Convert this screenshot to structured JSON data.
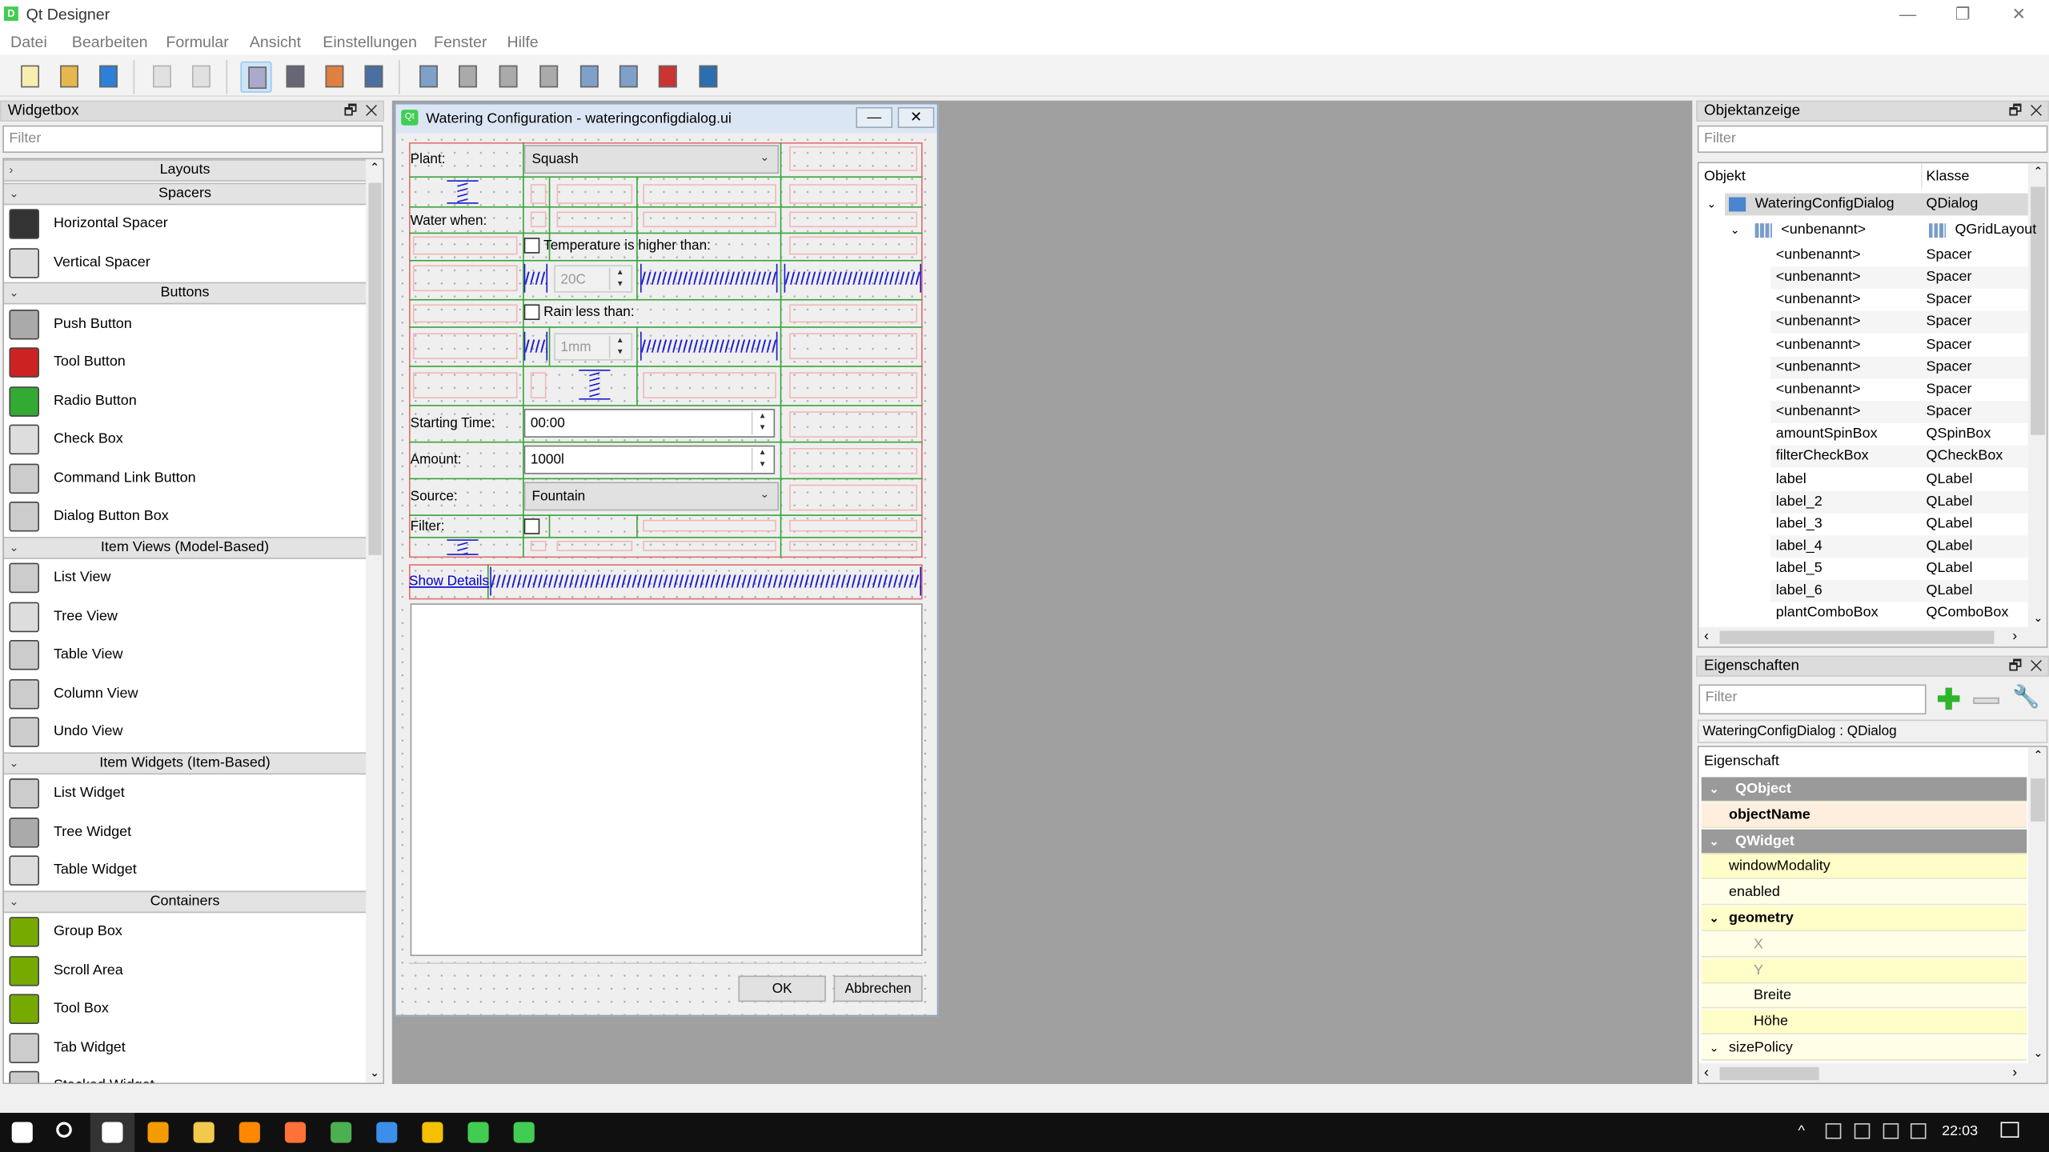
{
  "app": {
    "title": "Qt Designer",
    "icon": "qt-designer-icon"
  },
  "window_controls": {
    "minimize": "—",
    "maximize": "❐",
    "close": "✕"
  },
  "menu": [
    "Datei",
    "Bearbeiten",
    "Formular",
    "Ansicht",
    "Einstellungen",
    "Fenster",
    "Hilfe"
  ],
  "toolbar": [
    {
      "icon": "new-file-icon",
      "enabled": true
    },
    {
      "icon": "open-folder-icon",
      "enabled": true
    },
    {
      "icon": "save-icon",
      "enabled": true
    },
    {
      "icon": "bring-to-front-icon",
      "enabled": false
    },
    {
      "icon": "send-to-back-icon",
      "enabled": false
    },
    {
      "icon": "edit-widgets-icon",
      "enabled": true,
      "active": true
    },
    {
      "icon": "edit-signals-slots-icon",
      "enabled": true
    },
    {
      "icon": "edit-buddies-icon",
      "enabled": true
    },
    {
      "icon": "edit-tab-order-icon",
      "enabled": true
    },
    {
      "icon": "layout-horizontal-icon",
      "enabled": true
    },
    {
      "icon": "layout-vertical-icon",
      "enabled": true
    },
    {
      "icon": "splitter-horizontal-icon",
      "enabled": true
    },
    {
      "icon": "splitter-vertical-icon",
      "enabled": true
    },
    {
      "icon": "layout-grid-icon",
      "enabled": true
    },
    {
      "icon": "layout-form-icon",
      "enabled": true
    },
    {
      "icon": "break-layout-icon",
      "enabled": true
    },
    {
      "icon": "adjust-size-icon",
      "enabled": true
    }
  ],
  "widgetbox": {
    "title": "Widgetbox",
    "filter_placeholder": "Filter",
    "sections": [
      {
        "type": "cat",
        "label": "Layouts",
        "collapsed": true
      },
      {
        "type": "cat",
        "label": "Spacers"
      },
      {
        "type": "item",
        "label": "Horizontal Spacer",
        "icon": "horizontal-spacer-icon"
      },
      {
        "type": "item",
        "label": "Vertical Spacer",
        "icon": "vertical-spacer-icon"
      },
      {
        "type": "cat",
        "label": "Buttons"
      },
      {
        "type": "item",
        "label": "Push Button",
        "icon": "push-button-icon"
      },
      {
        "type": "item",
        "label": "Tool Button",
        "icon": "tool-button-icon"
      },
      {
        "type": "item",
        "label": "Radio Button",
        "icon": "radio-button-icon"
      },
      {
        "type": "item",
        "label": "Check Box",
        "icon": "check-box-icon"
      },
      {
        "type": "item",
        "label": "Command Link Button",
        "icon": "command-link-button-icon"
      },
      {
        "type": "item",
        "label": "Dialog Button Box",
        "icon": "dialog-button-box-icon"
      },
      {
        "type": "cat",
        "label": "Item Views (Model-Based)"
      },
      {
        "type": "item",
        "label": "List View",
        "icon": "list-view-icon"
      },
      {
        "type": "item",
        "label": "Tree View",
        "icon": "tree-view-icon"
      },
      {
        "type": "item",
        "label": "Table View",
        "icon": "table-view-icon"
      },
      {
        "type": "item",
        "label": "Column View",
        "icon": "column-view-icon"
      },
      {
        "type": "item",
        "label": "Undo View",
        "icon": "undo-view-icon"
      },
      {
        "type": "cat",
        "label": "Item Widgets (Item-Based)"
      },
      {
        "type": "item",
        "label": "List Widget",
        "icon": "list-widget-icon"
      },
      {
        "type": "item",
        "label": "Tree Widget",
        "icon": "tree-widget-icon"
      },
      {
        "type": "item",
        "label": "Table Widget",
        "icon": "table-widget-icon"
      },
      {
        "type": "cat",
        "label": "Containers"
      },
      {
        "type": "item",
        "label": "Group Box",
        "icon": "group-box-icon"
      },
      {
        "type": "item",
        "label": "Scroll Area",
        "icon": "scroll-area-icon"
      },
      {
        "type": "item",
        "label": "Tool Box",
        "icon": "tool-box-icon"
      },
      {
        "type": "item",
        "label": "Tab Widget",
        "icon": "tab-widget-icon"
      },
      {
        "type": "item",
        "label": "Stacked Widget",
        "icon": "stacked-widget-icon"
      }
    ]
  },
  "dialog": {
    "title": "Watering Configuration - wateringconfigdialog.ui",
    "labels": {
      "plant": "Plant:",
      "water_when": "Water when:",
      "starting_time": "Starting Time:",
      "amount": "Amount:",
      "source": "Source:",
      "filter": "Filter:"
    },
    "plant_combo": "Squash",
    "temperature_checkbox": {
      "label": "Temperature is higher than:",
      "checked": false
    },
    "temperature_spin": "20C",
    "rain_checkbox": {
      "label": "Rain less than:",
      "checked": false
    },
    "rain_spin": "1mm",
    "starting_time": "00:00",
    "amount": "1000l",
    "source_combo": "Fountain",
    "filter_checked": false,
    "show_details": "Show Details",
    "ok": "OK",
    "cancel": "Abbrechen"
  },
  "object_inspector": {
    "title": "Objektanzeige",
    "filter_placeholder": "Filter",
    "columns": [
      "Objekt",
      "Klasse"
    ],
    "rows": [
      {
        "object": "WateringConfigDialog",
        "class": "QDialog",
        "level": 0,
        "expanded": true,
        "selected": true
      },
      {
        "object": "<unbenannt>",
        "class": "QGridLayout",
        "level": 1,
        "expanded": true
      },
      {
        "object": "<unbenannt>",
        "class": "Spacer",
        "level": 2
      },
      {
        "object": "<unbenannt>",
        "class": "Spacer",
        "level": 2
      },
      {
        "object": "<unbenannt>",
        "class": "Spacer",
        "level": 2
      },
      {
        "object": "<unbenannt>",
        "class": "Spacer",
        "level": 2
      },
      {
        "object": "<unbenannt>",
        "class": "Spacer",
        "level": 2
      },
      {
        "object": "<unbenannt>",
        "class": "Spacer",
        "level": 2
      },
      {
        "object": "<unbenannt>",
        "class": "Spacer",
        "level": 2
      },
      {
        "object": "<unbenannt>",
        "class": "Spacer",
        "level": 2
      },
      {
        "object": "amountSpinBox",
        "class": "QSpinBox",
        "level": 2
      },
      {
        "object": "filterCheckBox",
        "class": "QCheckBox",
        "level": 2
      },
      {
        "object": "label",
        "class": "QLabel",
        "level": 2
      },
      {
        "object": "label_2",
        "class": "QLabel",
        "level": 2
      },
      {
        "object": "label_3",
        "class": "QLabel",
        "level": 2
      },
      {
        "object": "label_4",
        "class": "QLabel",
        "level": 2
      },
      {
        "object": "label_5",
        "class": "QLabel",
        "level": 2
      },
      {
        "object": "label_6",
        "class": "QLabel",
        "level": 2
      },
      {
        "object": "plantComboBox",
        "class": "QComboBox",
        "level": 2
      }
    ]
  },
  "property_editor": {
    "title": "Eigenschaften",
    "filter_placeholder": "Filter",
    "context": "WateringConfigDialog : QDialog",
    "column": "Eigenschaft",
    "rows": [
      {
        "label": "QObject",
        "kind": "group"
      },
      {
        "label": "objectName",
        "kind": "bold-orange"
      },
      {
        "label": "QWidget",
        "kind": "group"
      },
      {
        "label": "windowModality",
        "kind": "prop"
      },
      {
        "label": "enabled",
        "kind": "prop"
      },
      {
        "label": "geometry",
        "kind": "bold-expand"
      },
      {
        "label": "X",
        "kind": "sub-dim"
      },
      {
        "label": "Y",
        "kind": "sub-dim"
      },
      {
        "label": "Breite",
        "kind": "sub"
      },
      {
        "label": "Höhe",
        "kind": "sub"
      },
      {
        "label": "sizePolicy",
        "kind": "expand"
      }
    ]
  },
  "taskbar": {
    "apps": [
      "windows-start-icon",
      "search-icon",
      "photos-icon",
      "sublime-text-icon",
      "file-explorer-icon",
      "xampp-icon",
      "firefox-icon",
      "chrome-icon",
      "thunderbird-icon",
      "starred-app-icon",
      "qt-creator-icon",
      "qt-designer-icon"
    ],
    "tray": [
      "tray-overflow-icon",
      "color-app-icon",
      "teamviewer-icon",
      "network-icon",
      "volume-icon"
    ],
    "time": "22:03"
  },
  "colors": {
    "grid_layout": "#3aa33a",
    "form_border": "#e07070",
    "spacer": "#1a1acc",
    "group_row": "#9a9a9a",
    "prop_yellow": "#fffdc8",
    "prop_orange": "#fdeedd"
  }
}
